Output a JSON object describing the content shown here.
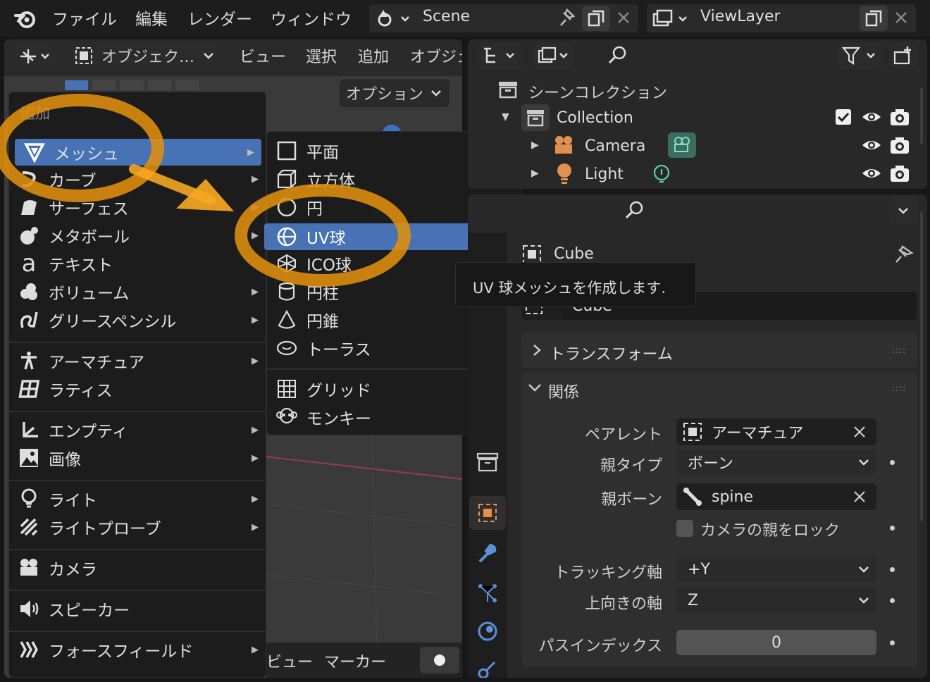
{
  "topbar": {
    "menus": [
      "ファイル",
      "編集",
      "レンダー",
      "ウィンドウ"
    ],
    "scene": "Scene",
    "view_layer": "ViewLayer"
  },
  "viewport": {
    "mode": "オブジェク…",
    "menus": [
      "ビュー",
      "選択",
      "追加",
      "オブジェ"
    ],
    "options": "オプション",
    "bottom_menus": [
      "ビュー",
      "マーカー"
    ]
  },
  "add_menu": {
    "title": "追加",
    "items": [
      {
        "label": "メッシュ",
        "icon": "mesh-icon",
        "submenu": true
      },
      {
        "label": "カーブ",
        "icon": "curve-icon",
        "submenu": true
      },
      {
        "label": "サーフェス",
        "icon": "surface-icon",
        "submenu": true
      },
      {
        "label": "メタボール",
        "icon": "metaball-icon",
        "submenu": true
      },
      {
        "label": "テキスト",
        "icon": "text-icon",
        "submenu": false
      },
      {
        "label": "ボリューム",
        "icon": "volume-icon",
        "submenu": true
      },
      {
        "label": "グリースペンシル",
        "icon": "grease-pencil-icon",
        "submenu": true
      },
      {
        "label": "アーマチュア",
        "icon": "armature-icon",
        "submenu": true
      },
      {
        "label": "ラティス",
        "icon": "lattice-icon",
        "submenu": false
      },
      {
        "label": "エンプティ",
        "icon": "empty-icon",
        "submenu": true
      },
      {
        "label": "画像",
        "icon": "image-icon",
        "submenu": true
      },
      {
        "label": "ライト",
        "icon": "light-icon",
        "submenu": true
      },
      {
        "label": "ライトプローブ",
        "icon": "light-probe-icon",
        "submenu": true
      },
      {
        "label": "カメラ",
        "icon": "camera-icon",
        "submenu": false
      },
      {
        "label": "スピーカー",
        "icon": "speaker-icon",
        "submenu": false
      },
      {
        "label": "フォースフィールド",
        "icon": "force-field-icon",
        "submenu": true
      }
    ]
  },
  "mesh_menu": {
    "items": [
      {
        "label": "平面",
        "icon": "plane-icon"
      },
      {
        "label": "立方体",
        "icon": "cube-icon"
      },
      {
        "label": "円",
        "icon": "circle-icon"
      },
      {
        "label": "UV球",
        "icon": "uv-sphere-icon"
      },
      {
        "label": "ICO球",
        "icon": "ico-sphere-icon"
      },
      {
        "label": "円柱",
        "icon": "cylinder-icon"
      },
      {
        "label": "円錐",
        "icon": "cone-icon"
      },
      {
        "label": "トーラス",
        "icon": "torus-icon"
      },
      {
        "label": "グリッド",
        "icon": "grid-icon"
      },
      {
        "label": "モンキー",
        "icon": "monkey-icon"
      }
    ]
  },
  "tooltip": "UV 球メッシュを作成します.",
  "outliner": {
    "scene_collection": "シーンコレクション",
    "collection": "Collection",
    "camera": "Camera",
    "light": "Light"
  },
  "properties": {
    "object_name": "Cube",
    "name_field": "Cube",
    "transform": "トランスフォーム",
    "relations": "関係",
    "parent_label": "ペアレント",
    "parent_value": "アーマチュア",
    "parent_type_label": "親タイプ",
    "parent_type_value": "ボーン",
    "parent_bone_label": "親ボーン",
    "parent_bone_value": "spine",
    "lock_camera": "カメラの親をロック",
    "tracking_label": "トラッキング軸",
    "tracking_value": "+Y",
    "up_label": "上向きの軸",
    "up_value": "Z",
    "pass_label": "パスインデックス",
    "pass_value": "0"
  },
  "colors": {
    "highlight": "#4772b3",
    "annotation": "#f5a623"
  }
}
